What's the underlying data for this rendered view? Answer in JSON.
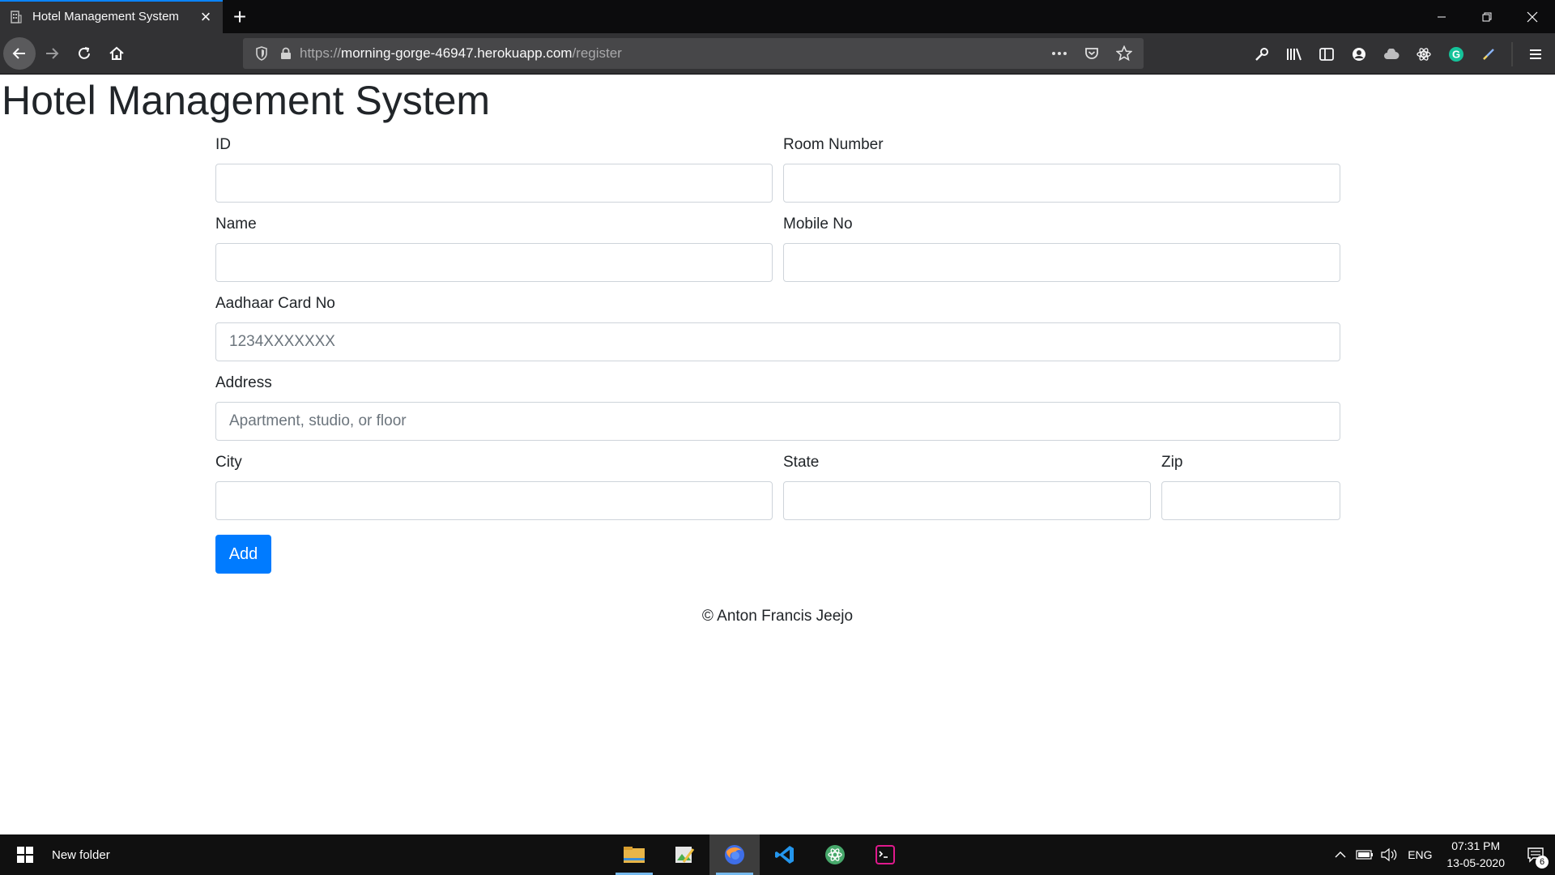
{
  "browser": {
    "tab_title": "Hotel Management System",
    "url_prefix": "https://",
    "url_host": "morning-gorge-46947.herokuapp.com",
    "url_path": "/register"
  },
  "page": {
    "heading": "Hotel Management System",
    "form": {
      "id_label": "ID",
      "room_label": "Room Number",
      "name_label": "Name",
      "mobile_label": "Mobile No",
      "aadhaar_label": "Aadhaar Card No",
      "aadhaar_placeholder": "1234XXXXXXX",
      "address_label": "Address",
      "address_placeholder": "Apartment, studio, or floor",
      "city_label": "City",
      "state_label": "State",
      "zip_label": "Zip",
      "submit_label": "Add"
    },
    "footer": "© Anton Francis Jeejo"
  },
  "taskbar": {
    "folder_label": "New folder",
    "language": "ENG",
    "time": "07:31 PM",
    "date": "13-05-2020",
    "notification_count": "6"
  },
  "colors": {
    "accent": "#007bff",
    "tab_indicator": "#0a84ff"
  }
}
